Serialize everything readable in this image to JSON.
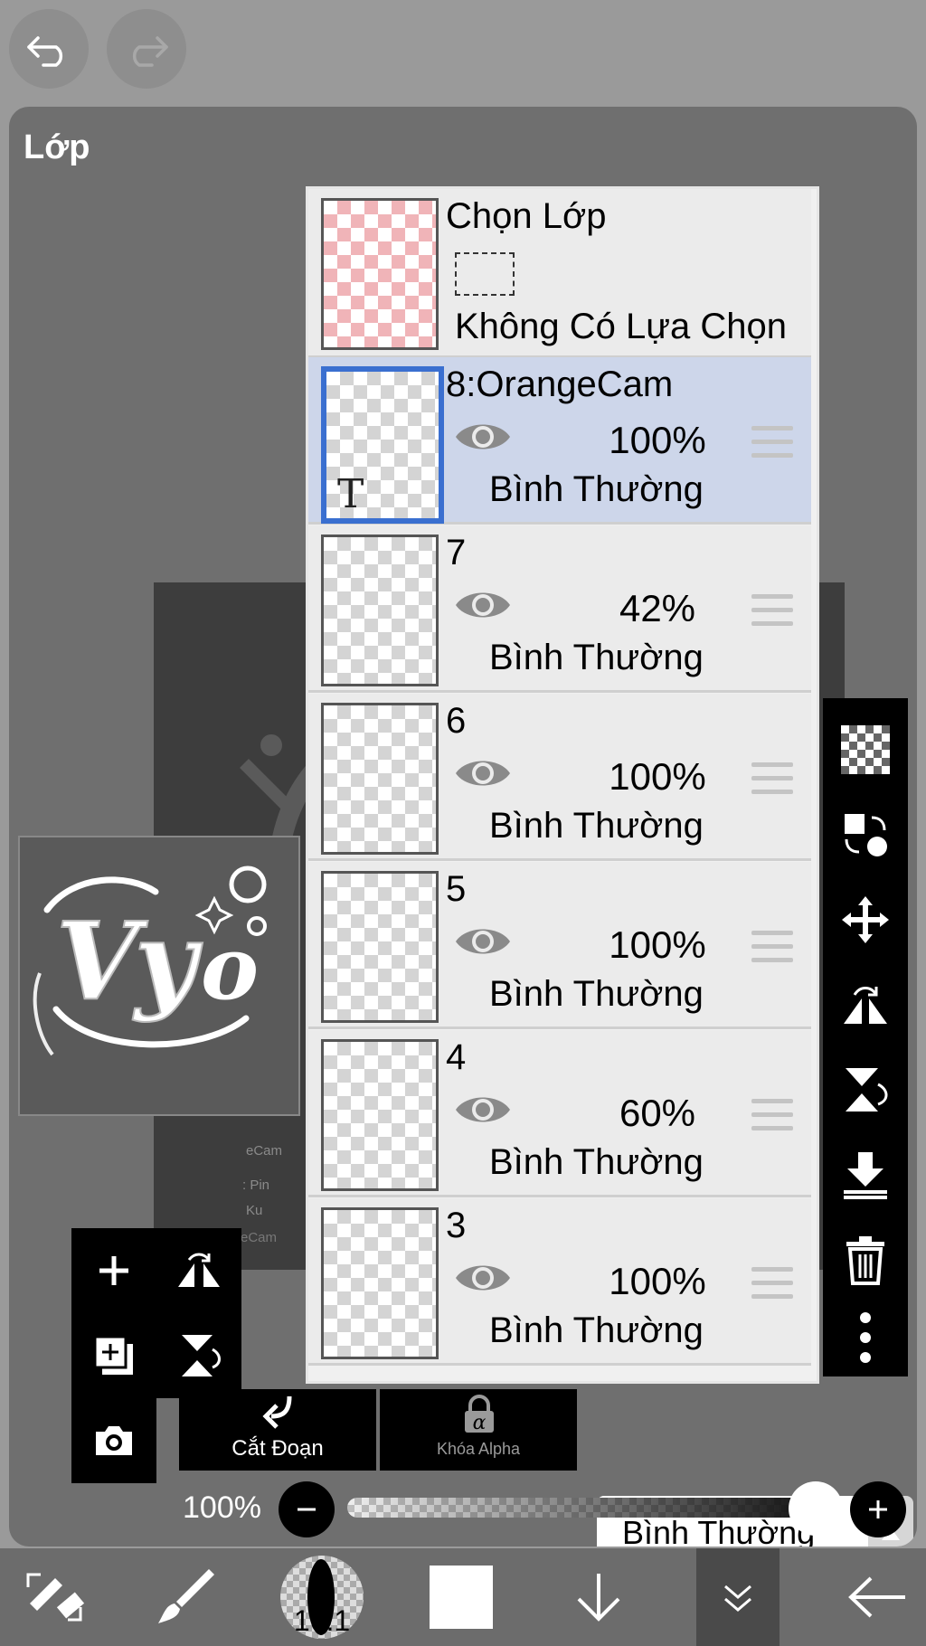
{
  "panel": {
    "title": "Lớp"
  },
  "selection_layer": {
    "title": "Chọn Lớp",
    "status": "Không Có Lựa Chọn"
  },
  "layers": [
    {
      "name": "8:OrangeCam",
      "opacity": "100%",
      "blend": "Bình Thường",
      "selected": true,
      "text_badge": "T"
    },
    {
      "name": "7",
      "opacity": "42%",
      "blend": "Bình Thường",
      "selected": false
    },
    {
      "name": "6",
      "opacity": "100%",
      "blend": "Bình Thường",
      "selected": false
    },
    {
      "name": "5",
      "opacity": "100%",
      "blend": "Bình Thường",
      "selected": false
    },
    {
      "name": "4",
      "opacity": "60%",
      "blend": "Bình Thường",
      "selected": false
    },
    {
      "name": "3",
      "opacity": "100%",
      "blend": "Bình Thường",
      "selected": false
    }
  ],
  "buttons": {
    "clipping": "Cắt Đoạn",
    "alpha_lock": "Khóa Alpha"
  },
  "blend_mode": {
    "value": "Bình Thường"
  },
  "opacity": {
    "label": "100%",
    "value": 1.0
  },
  "brush": {
    "size": "16.1"
  },
  "canvas_text": {
    "line1": "eCam",
    "line2": ": Pin",
    "line3": "Ku"
  },
  "thumbnail": {
    "logo_text": "Vy"
  },
  "colors": {
    "accent": "#3a6fd0",
    "selected_row": "#cdd6ea",
    "panel": "#6f6f6f"
  }
}
